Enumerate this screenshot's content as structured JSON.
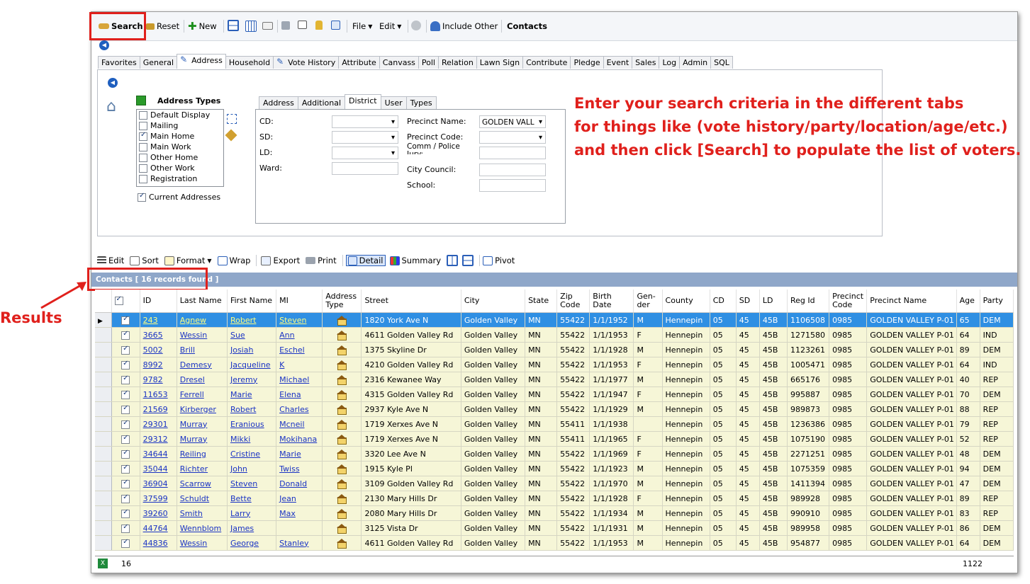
{
  "toolbar": {
    "search": "Search",
    "reset": "Reset",
    "new": "New",
    "file": "File",
    "edit": "Edit",
    "include_other": "Include Other",
    "contacts": "Contacts"
  },
  "tabs": [
    "Favorites",
    "General",
    "Address",
    "Household",
    "Vote History",
    "Attribute",
    "Canvass",
    "Poll",
    "Relation",
    "Lawn Sign",
    "Contribute",
    "Pledge",
    "Event",
    "Sales",
    "Log",
    "Admin",
    "SQL"
  ],
  "address_types": {
    "title": "Address Types",
    "items": [
      {
        "label": "Default Display",
        "checked": false
      },
      {
        "label": "Mailing",
        "checked": false
      },
      {
        "label": "Main Home",
        "checked": true
      },
      {
        "label": "Main Work",
        "checked": false
      },
      {
        "label": "Other Home",
        "checked": false
      },
      {
        "label": "Other Work",
        "checked": false
      },
      {
        "label": "Registration",
        "checked": false
      }
    ],
    "current_addresses": "Current Addresses"
  },
  "subtabs": [
    "Address",
    "Additional",
    "District",
    "User",
    "Types"
  ],
  "district": {
    "cd": "CD:",
    "sd": "SD:",
    "ld": "LD:",
    "ward": "Ward:",
    "precinct_name": "Precinct Name:",
    "precinct_name_value": "GOLDEN VALL",
    "precinct_code": "Precinct Code:",
    "comm_police": "Comm / Police Jury:",
    "city_council": "City Council:",
    "school": "School:"
  },
  "callout": {
    "line1": "Enter your search criteria in the different tabs",
    "line2": "for things like (vote history/party/location/age/etc.)",
    "line3": "and then click [Search] to populate the list of voters."
  },
  "grid_toolbar": {
    "edit": "Edit",
    "sort": "Sort",
    "format": "Format",
    "wrap": "Wrap",
    "export": "Export",
    "print": "Print",
    "detail": "Detail",
    "summary": "Summary",
    "pivot": "Pivot"
  },
  "group_bar": "Contacts [ 16 records found ]",
  "results_label": "Results",
  "columns": [
    "ID",
    "Last Name",
    "First Name",
    "MI",
    "Address Type",
    "Street",
    "City",
    "State",
    "Zip Code",
    "Birth Date",
    "Gen-der",
    "County",
    "CD",
    "SD",
    "LD",
    "Reg Id",
    "Precinct Code",
    "Precinct Name",
    "Age",
    "Party"
  ],
  "rows": [
    [
      "243",
      "Agnew",
      "Robert",
      "Steven",
      "1820 York Ave N",
      "Golden Valley",
      "MN",
      "55422",
      "1/1/1952",
      "M",
      "Hennepin",
      "05",
      "45",
      "45B",
      "1106508",
      "0985",
      "GOLDEN VALLEY P-01",
      "65",
      "DEM"
    ],
    [
      "3665",
      "Wessin",
      "Sue",
      "Ann",
      "4611 Golden Valley Rd",
      "Golden Valley",
      "MN",
      "55422",
      "1/1/1953",
      "F",
      "Hennepin",
      "05",
      "45",
      "45B",
      "1271580",
      "0985",
      "GOLDEN VALLEY P-01",
      "64",
      "IND"
    ],
    [
      "5002",
      "Brill",
      "Josiah",
      "Eschel",
      "1375 Skyline Dr",
      "Golden Valley",
      "MN",
      "55422",
      "1/1/1928",
      "M",
      "Hennepin",
      "05",
      "45",
      "45B",
      "1123261",
      "0985",
      "GOLDEN VALLEY P-01",
      "89",
      "DEM"
    ],
    [
      "8992",
      "Demesy",
      "Jacqueline",
      "K",
      "4210 Golden Valley Rd",
      "Golden Valley",
      "MN",
      "55422",
      "1/1/1953",
      "F",
      "Hennepin",
      "05",
      "45",
      "45B",
      "1005471",
      "0985",
      "GOLDEN VALLEY P-01",
      "64",
      "IND"
    ],
    [
      "9782",
      "Dresel",
      "Jeremy",
      "Michael",
      "2316 Kewanee Way",
      "Golden Valley",
      "MN",
      "55422",
      "1/1/1977",
      "M",
      "Hennepin",
      "05",
      "45",
      "45B",
      "665176",
      "0985",
      "GOLDEN VALLEY P-01",
      "40",
      "REP"
    ],
    [
      "11653",
      "Ferrell",
      "Marie",
      "Elena",
      "4315 Golden Valley Rd",
      "Golden Valley",
      "MN",
      "55422",
      "1/1/1947",
      "F",
      "Hennepin",
      "05",
      "45",
      "45B",
      "995887",
      "0985",
      "GOLDEN VALLEY P-01",
      "70",
      "DEM"
    ],
    [
      "21569",
      "Kirberger",
      "Robert",
      "Charles",
      "2937 Kyle Ave N",
      "Golden Valley",
      "MN",
      "55422",
      "1/1/1929",
      "M",
      "Hennepin",
      "05",
      "45",
      "45B",
      "989873",
      "0985",
      "GOLDEN VALLEY P-01",
      "88",
      "REP"
    ],
    [
      "29301",
      "Murray",
      "Eranious",
      "Mcneil",
      "1719 Xerxes Ave N",
      "Golden Valley",
      "MN",
      "55411",
      "1/1/1938",
      "",
      "Hennepin",
      "05",
      "45",
      "45B",
      "1236386",
      "0985",
      "GOLDEN VALLEY P-01",
      "79",
      "REP"
    ],
    [
      "29312",
      "Murray",
      "Mikki",
      "Mokihana",
      "1719 Xerxes Ave N",
      "Golden Valley",
      "MN",
      "55411",
      "1/1/1965",
      "F",
      "Hennepin",
      "05",
      "45",
      "45B",
      "1075190",
      "0985",
      "GOLDEN VALLEY P-01",
      "52",
      "REP"
    ],
    [
      "34644",
      "Reiling",
      "Cristine",
      "Marie",
      "3320 Lee Ave N",
      "Golden Valley",
      "MN",
      "55422",
      "1/1/1969",
      "F",
      "Hennepin",
      "05",
      "45",
      "45B",
      "2271251",
      "0985",
      "GOLDEN VALLEY P-01",
      "48",
      "DEM"
    ],
    [
      "35044",
      "Richter",
      "John",
      "Twiss",
      "1915 Kyle Pl",
      "Golden Valley",
      "MN",
      "55422",
      "1/1/1923",
      "M",
      "Hennepin",
      "05",
      "45",
      "45B",
      "1075359",
      "0985",
      "GOLDEN VALLEY P-01",
      "94",
      "DEM"
    ],
    [
      "36904",
      "Scarrow",
      "Steven",
      "Donald",
      "3109 Golden Valley Rd",
      "Golden Valley",
      "MN",
      "55422",
      "1/1/1970",
      "M",
      "Hennepin",
      "05",
      "45",
      "45B",
      "1411394",
      "0985",
      "GOLDEN VALLEY P-01",
      "47",
      "DEM"
    ],
    [
      "37599",
      "Schuldt",
      "Bette",
      "Jean",
      "2130 Mary Hills Dr",
      "Golden Valley",
      "MN",
      "55422",
      "1/1/1928",
      "F",
      "Hennepin",
      "05",
      "45",
      "45B",
      "989928",
      "0985",
      "GOLDEN VALLEY P-01",
      "89",
      "REP"
    ],
    [
      "39260",
      "Smith",
      "Larry",
      "Max",
      "2080 Mary Hills Dr",
      "Golden Valley",
      "MN",
      "55422",
      "1/1/1934",
      "M",
      "Hennepin",
      "05",
      "45",
      "45B",
      "990910",
      "0985",
      "GOLDEN VALLEY P-01",
      "83",
      "REP"
    ],
    [
      "44764",
      "Wennblom",
      "James",
      "",
      "3125 Vista Dr",
      "Golden Valley",
      "MN",
      "55422",
      "1/1/1931",
      "M",
      "Hennepin",
      "05",
      "45",
      "45B",
      "989958",
      "0985",
      "GOLDEN VALLEY P-01",
      "86",
      "DEM"
    ],
    [
      "44836",
      "Wessin",
      "George",
      "Stanley",
      "4611 Golden Valley Rd",
      "Golden Valley",
      "MN",
      "55422",
      "1/1/1953",
      "M",
      "Hennepin",
      "05",
      "45",
      "45B",
      "954877",
      "0985",
      "GOLDEN VALLEY P-01",
      "64",
      "DEM"
    ]
  ],
  "footer": {
    "count": "16",
    "age_sum": "1122"
  },
  "colors": {
    "accent_red": "#e0201c",
    "selected_row": "#2f8fe3",
    "row_bg": "#f6f6d7",
    "group_bar": "#8fa7c9"
  }
}
